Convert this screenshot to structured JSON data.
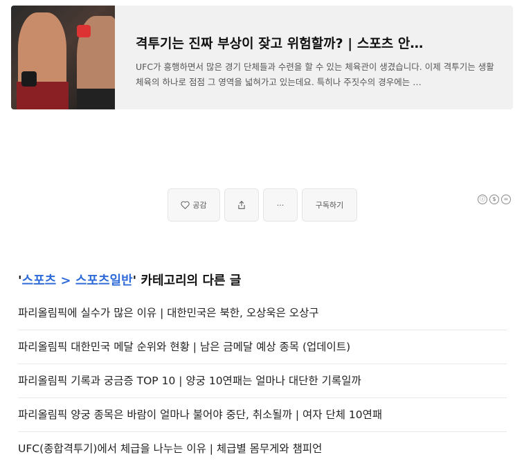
{
  "card": {
    "title": "격투기는 진짜 부상이 잦고 위험할까? | 스포츠 안…",
    "description": "UFC가 흥행하면서 많은 경기 단체들과 수련을 할 수 있는 체육관이 생겼습니다. 이제 격투기는 생활 체육의 하나로 점점 그 영역을 넓혀가고 있는데요. 특히나 주짓수의 경우에는 …"
  },
  "actions": {
    "like_label": "공감",
    "more_label": "···",
    "subscribe_label": "구독하기"
  },
  "cc_icons": [
    "ⓘ",
    "$",
    "="
  ],
  "related": {
    "prefix": "'",
    "category1": "스포츠",
    "separator": " > ",
    "category2": "스포츠일반",
    "suffix": "' 카테고리의 다른 글"
  },
  "posts": [
    "파리올림픽에 실수가 많은 이유 | 대한민국은 북한, 오상욱은 오상구",
    "파리올림픽 대한민국 메달 순위와 현황 | 남은 금메달 예상 종목 (업데이트)",
    "파리올림픽 기록과 궁금증 TOP 10 | 양궁 10연패는 얼마나 대단한 기록일까",
    "파리올림픽 양궁 종목은 바람이 얼마나 불어야 중단, 취소될까 | 여자 단체 10연패",
    "UFC(종합격투기)에서 체급을 나누는 이유  |  체급별 몸무게와 챔피언"
  ]
}
